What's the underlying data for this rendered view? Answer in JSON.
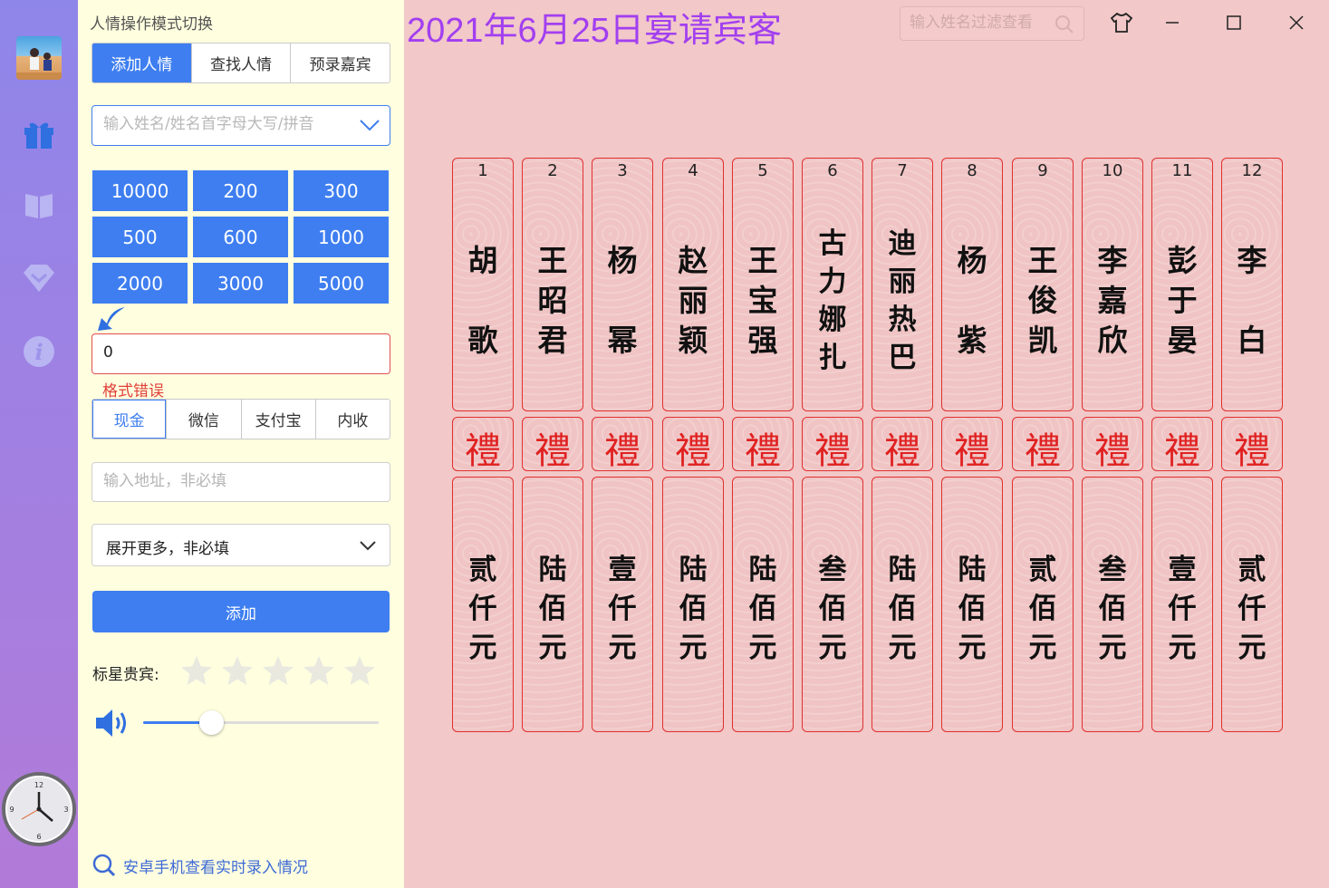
{
  "header": {
    "title": "2021年6月25日宴请宾客",
    "filter_placeholder": "输入姓名过滤查看"
  },
  "panel": {
    "title": "人情操作模式切换",
    "modes": [
      "添加人情",
      "查找人情",
      "预录嘉宾"
    ],
    "active_mode": 0,
    "name_placeholder": "输入姓名/姓名首字母大写/拼音",
    "amount_presets": [
      "10000",
      "200",
      "300",
      "500",
      "600",
      "1000",
      "2000",
      "3000",
      "5000"
    ],
    "amount_value": "0",
    "error_text": "格式错误",
    "pay_methods": [
      "现金",
      "微信",
      "支付宝",
      "内收"
    ],
    "active_pay": 0,
    "address_placeholder": "输入地址，非必填",
    "more_label": "展开更多，非必填",
    "add_button": "添加",
    "star_label": "标星贵宾:",
    "star_count": 5,
    "stars_selected": 0,
    "volume": 0.29,
    "bottom_link": "安卓手机查看实时录入情况"
  },
  "gift_char": "禮",
  "entries": [
    {
      "index": "1",
      "name": [
        "胡",
        "歌"
      ],
      "amount": [
        "贰",
        "仟",
        "元"
      ]
    },
    {
      "index": "2",
      "name": [
        "王",
        "昭",
        "君"
      ],
      "amount": [
        "陆",
        "佰",
        "元"
      ]
    },
    {
      "index": "3",
      "name": [
        "杨",
        "幂"
      ],
      "amount": [
        "壹",
        "仟",
        "元"
      ]
    },
    {
      "index": "4",
      "name": [
        "赵",
        "丽",
        "颖"
      ],
      "amount": [
        "陆",
        "佰",
        "元"
      ]
    },
    {
      "index": "5",
      "name": [
        "王",
        "宝",
        "强"
      ],
      "amount": [
        "陆",
        "佰",
        "元"
      ]
    },
    {
      "index": "6",
      "name": [
        "古",
        "力",
        "娜",
        "扎"
      ],
      "amount": [
        "叁",
        "佰",
        "元"
      ]
    },
    {
      "index": "7",
      "name": [
        "迪",
        "丽",
        "热",
        "巴"
      ],
      "amount": [
        "陆",
        "佰",
        "元"
      ]
    },
    {
      "index": "8",
      "name": [
        "杨",
        "紫"
      ],
      "amount": [
        "陆",
        "佰",
        "元"
      ]
    },
    {
      "index": "9",
      "name": [
        "王",
        "俊",
        "凯"
      ],
      "amount": [
        "贰",
        "佰",
        "元"
      ]
    },
    {
      "index": "10",
      "name": [
        "李",
        "嘉",
        "欣"
      ],
      "amount": [
        "叁",
        "佰",
        "元"
      ]
    },
    {
      "index": "11",
      "name": [
        "彭",
        "于",
        "晏"
      ],
      "amount": [
        "壹",
        "仟",
        "元"
      ]
    },
    {
      "index": "12",
      "name": [
        "李",
        "白"
      ],
      "amount": [
        "贰",
        "仟",
        "元"
      ]
    }
  ],
  "colors": {
    "accent": "#3e7ef0",
    "title": "#a23ff0",
    "background": "#f2c8c8",
    "panel": "#ffffe0",
    "error": "#e0403a",
    "gift_red": "#e02020"
  }
}
